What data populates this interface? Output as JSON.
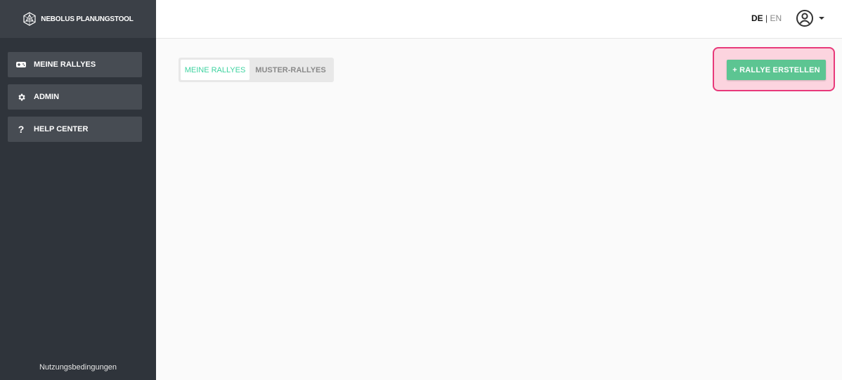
{
  "brand": {
    "title": "NEBOLUS PLANUNGSTOOL"
  },
  "sidebar": {
    "items": [
      {
        "label": "MEINE RALLYES",
        "icon": "gamepad-icon"
      },
      {
        "label": "ADMIN",
        "icon": "gear-icon"
      },
      {
        "label": "HELP CENTER",
        "icon": "question-icon"
      }
    ],
    "footer_link": "Nutzungsbedingungen"
  },
  "header": {
    "lang_active": "DE",
    "lang_separator": "|",
    "lang_other": "EN",
    "user_icon": "user-circle-icon"
  },
  "tabs": [
    {
      "label": "MEINE RALLYES",
      "active": true
    },
    {
      "label": "MUSTER-RALLYES",
      "active": false
    }
  ],
  "actions": {
    "create_label": "+ RALLYE ERSTELLEN"
  },
  "colors": {
    "sidebar_bg": "#2f343b",
    "accent_green": "#5cc592",
    "tab_active_text": "#3ed3a0",
    "highlight_border": "#e8397a",
    "highlight_fill": "#fcd4df"
  }
}
